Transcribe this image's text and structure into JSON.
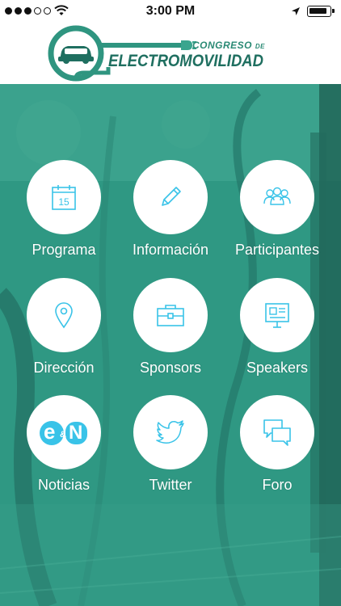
{
  "status_bar": {
    "time": "3:00 PM"
  },
  "header": {
    "logo_line1": "CONGRESO",
    "logo_line1_de": "DE",
    "logo_line2": "ELECTROMOVILIDAD"
  },
  "menu": {
    "items": [
      {
        "label": "Programa",
        "icon": "calendar-icon",
        "icon_text": "15"
      },
      {
        "label": "Información",
        "icon": "pencil-icon"
      },
      {
        "label": "Participantes",
        "icon": "people-icon"
      },
      {
        "label": "Dirección",
        "icon": "location-pin-icon"
      },
      {
        "label": "Sponsors",
        "icon": "briefcase-icon"
      },
      {
        "label": "Speakers",
        "icon": "presentation-icon"
      },
      {
        "label": "Noticias",
        "icon": "en-logo-icon",
        "icon_text_a": "e",
        "icon_text_amp": "&",
        "icon_text_b": "N"
      },
      {
        "label": "Twitter",
        "icon": "twitter-bird-icon"
      },
      {
        "label": "Foro",
        "icon": "chat-bubbles-icon"
      }
    ]
  },
  "colors": {
    "brand_green": "#2f9580",
    "logo_dark": "#1f6f60",
    "icon_blue": "#39c3e8",
    "label_text": "#ffffff"
  }
}
